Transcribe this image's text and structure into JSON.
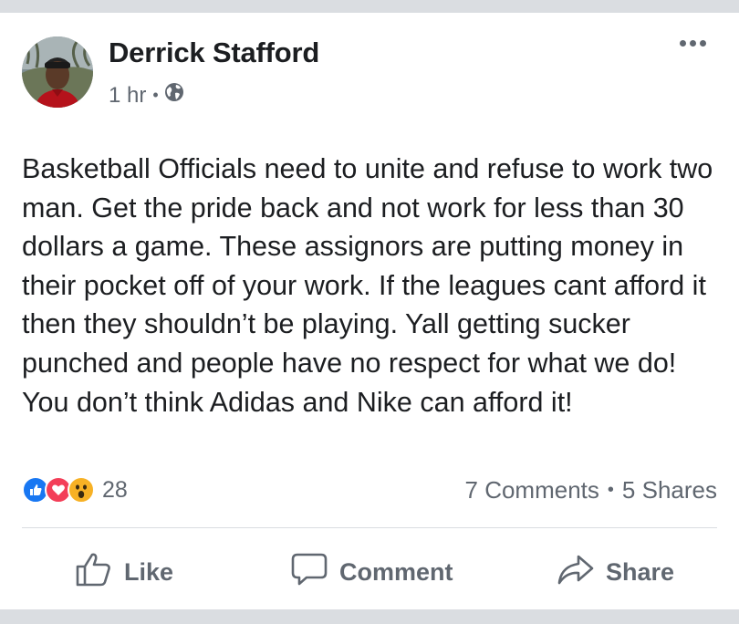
{
  "post": {
    "author": "Derrick Stafford",
    "time": "1 hr",
    "privacy_icon": "globe-icon",
    "more_icon": "more-options-icon",
    "text": "Basketball Officials need to unite and refuse to work two man. Get the pride back and not work for less than 30 dollars a game. These assignors are putting money in their pocket off of your work. If the leagues cant afford it then they shouldn’t be playing. Yall getting sucker punched and people have no respect for what we do! You don’t think Adidas and Nike can afford it!"
  },
  "reactions": {
    "icons": [
      "like-reaction-icon",
      "love-reaction-icon",
      "wow-reaction-icon"
    ],
    "count": "28"
  },
  "stats": {
    "comments": "7 Comments",
    "shares": "5 Shares"
  },
  "actions": {
    "like": "Like",
    "comment": "Comment",
    "share": "Share"
  },
  "colors": {
    "like_blue": "#1877f2",
    "love_red": "#f33e58",
    "wow_yellow": "#f7b125",
    "text": "#1c1e21",
    "secondary": "#606770"
  }
}
